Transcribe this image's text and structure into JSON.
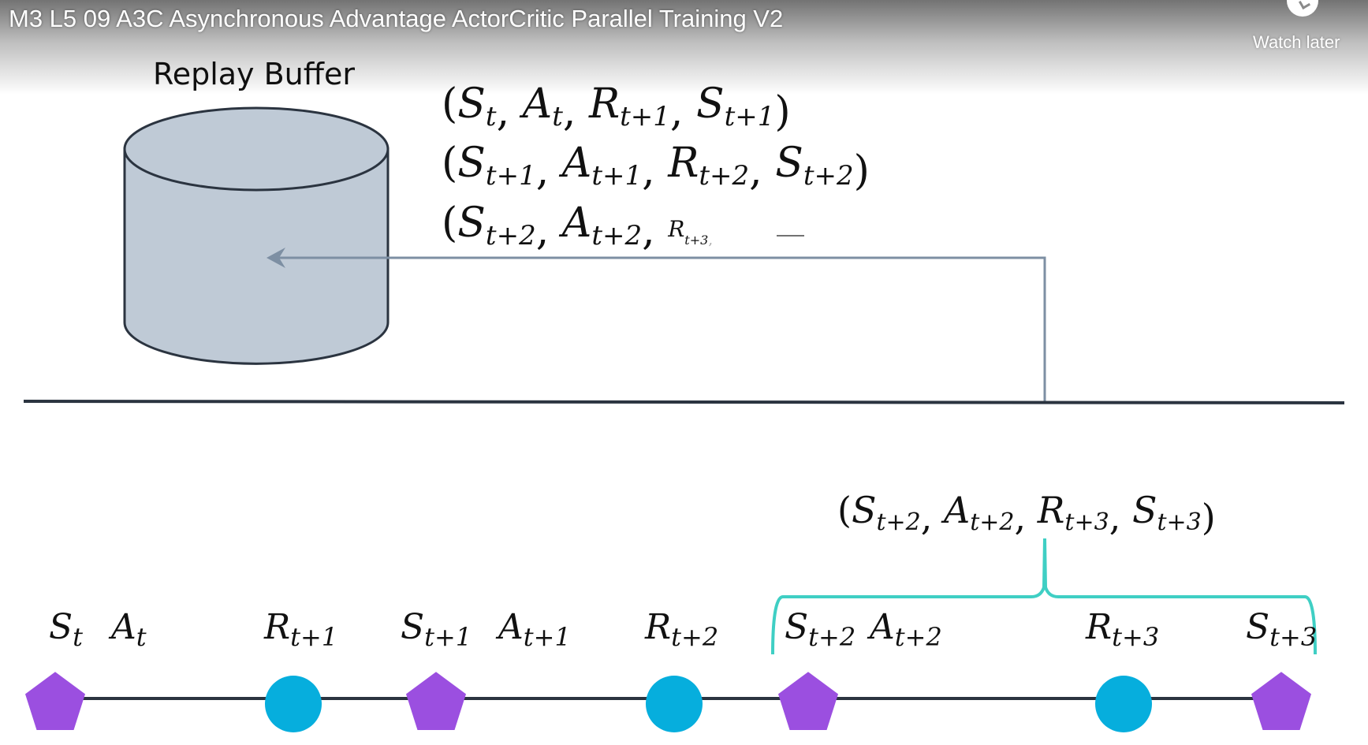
{
  "video": {
    "title": "M3 L5 09 A3C Asynchronous Advantage ActorCritic Parallel Training V2",
    "watch_later_label": "Watch later",
    "watch_later_icon": "clock-icon"
  },
  "slide": {
    "replay_buffer_label": "Replay Buffer",
    "buffer_entries": [
      [
        "(",
        "S",
        "t",
        ", ",
        "A",
        "t",
        ", ",
        "R",
        "t+1",
        ", ",
        "S",
        "t+1",
        ")"
      ],
      [
        "(",
        "S",
        "t+1",
        ", ",
        "A",
        "t+1",
        ", ",
        "R",
        "t+2",
        ", ",
        "S",
        "t+2",
        ")"
      ],
      [
        "(",
        "S",
        "t+2",
        ", ",
        "A",
        "t+2",
        ", ",
        "R",
        "t+3",
        ", ",
        "",
        "",
        ""
      ]
    ],
    "tuple_label": [
      "(",
      "S",
      "t+2",
      ", ",
      "A",
      "t+2",
      ", ",
      "R",
      "t+3",
      ", ",
      "S",
      "t+3",
      ")"
    ],
    "timeline": [
      {
        "kind": "state",
        "label": "S",
        "sub": "t",
        "action_label": "A",
        "action_sub": "t"
      },
      {
        "kind": "reward",
        "label": "R",
        "sub": "t+1"
      },
      {
        "kind": "state",
        "label": "S",
        "sub": "t+1",
        "action_label": "A",
        "action_sub": "t+1"
      },
      {
        "kind": "reward",
        "label": "R",
        "sub": "t+2"
      },
      {
        "kind": "state",
        "label": "S",
        "sub": "t+2",
        "action_label": "A",
        "action_sub": "t+2"
      },
      {
        "kind": "reward",
        "label": "R",
        "sub": "t+3"
      },
      {
        "kind": "state",
        "label": "S",
        "sub": "t+3"
      }
    ],
    "colors": {
      "cylinder_fill": "#bfcad6",
      "cylinder_stroke": "#2b3440",
      "arrow": "#7d8fa3",
      "divider": "#2b3440",
      "brace": "#3fcfc4",
      "state_node": "#9b4fe0",
      "reward_node": "#06aedd",
      "text": "#111111"
    }
  }
}
